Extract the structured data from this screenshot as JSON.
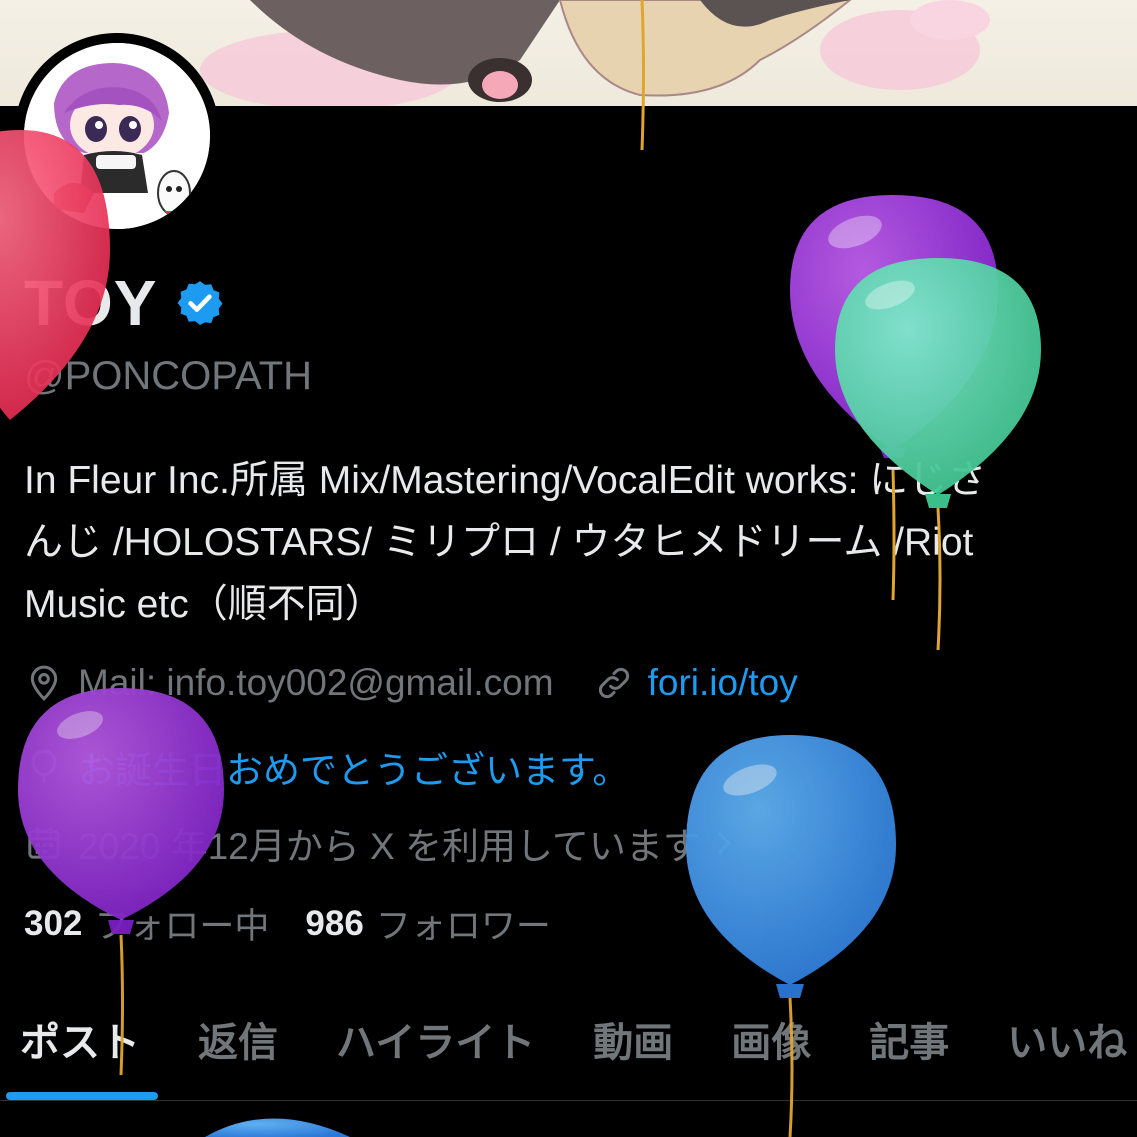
{
  "profile": {
    "name": "TOY",
    "handle": "@PONCOPATH",
    "bio_lines": [
      "In Fleur Inc.所属 Mix/Mastering/VocalEdit works: にじさ",
      "んじ /HOLOSTARS/ ミリプロ / ウタヒメドリーム /Riot",
      "Music etc（順不同）"
    ],
    "location": "Mail: info.toy002@gmail.com",
    "website": "fori.io/toy",
    "birthday": "お誕生日おめでとうございます。",
    "joined": "2020 年12月から X を利用しています",
    "following_count": "302",
    "following_label": "フォロー中",
    "followers_count": "986",
    "followers_label": "フォロワー"
  },
  "tabs": [
    "ポスト",
    "返信",
    "ハイライト",
    "動画",
    "画像",
    "記事",
    "いいね"
  ],
  "colors": {
    "background": "#000000",
    "accent": "#1d9bf0",
    "muted_text": "#71767b",
    "primary_text": "#e7e9ea"
  },
  "icons": {
    "verified": "verified-badge-icon",
    "location": "location-pin-icon",
    "link": "link-icon",
    "birthday": "balloon-icon",
    "calendar": "calendar-icon",
    "chevron": "chevron-right-icon"
  }
}
